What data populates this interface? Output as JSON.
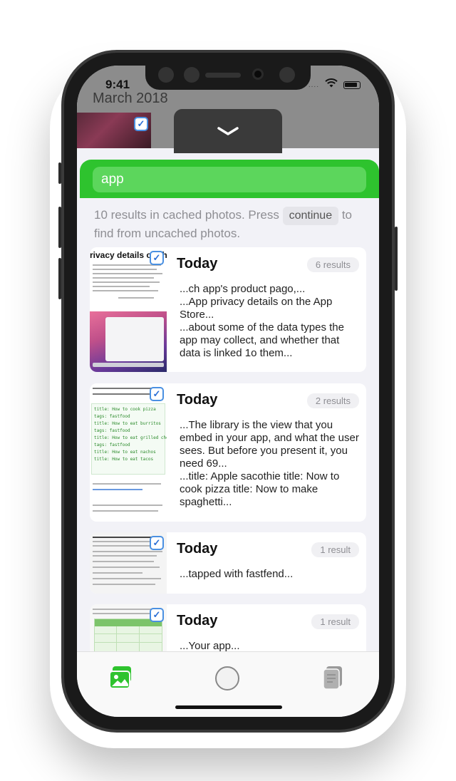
{
  "status_bar": {
    "time": "9:41",
    "signal": "....",
    "wifi_icon": "wifi-icon",
    "battery_icon": "battery-icon"
  },
  "header": {
    "date": "March 2018"
  },
  "search": {
    "value": "app",
    "placeholder": "",
    "accent_color": "#2ec32e"
  },
  "info": {
    "text_before": "10 results in cached photos. Press ",
    "continue_label": "continue",
    "text_after": " to find from uncached photos."
  },
  "results": [
    {
      "title": "Today",
      "badge": "6 results",
      "snippet": "...ch app's product pago,...\n...App privacy details on the App Store...\n...about some of the data types the app may collect, and whether that data is linked 1o them...",
      "thumb_heading": "rivacy details on th"
    },
    {
      "title": "Today",
      "badge": "2 results",
      "snippet": "...The library is the view that you embed in your app, and what the user sees. But before you present it, you need 69...\n...title: Apple sacothie title: Now to cook pizza title: Now to make spaghetti...",
      "thumb_code_1": "title: How to cook pizza",
      "thumb_code_2": "title: How to eat burritos",
      "thumb_code_3": "title: How to eat grilled cheese",
      "thumb_code_4": "title: How to eat nachos",
      "thumb_code_5": "title: How to eat tacos",
      "thumb_tag": "tags: fastfood"
    },
    {
      "title": "Today",
      "badge": "1 result",
      "snippet": "...tapped with fastfend..."
    },
    {
      "title": "Today",
      "badge": "1 result",
      "snippet": "...Your app..."
    }
  ],
  "tab_bar": {
    "items": [
      {
        "icon": "photos-icon",
        "active": true
      },
      {
        "icon": "capture-circle-icon",
        "active": false
      },
      {
        "icon": "documents-icon",
        "active": false
      }
    ]
  }
}
